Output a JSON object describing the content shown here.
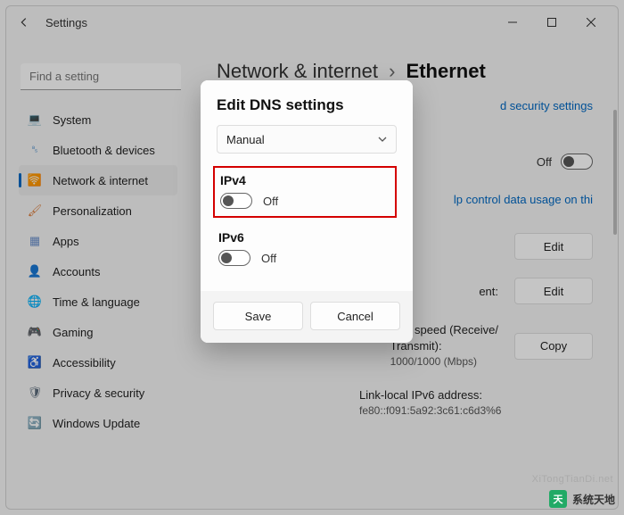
{
  "titlebar": {
    "app_title": "Settings"
  },
  "search": {
    "placeholder": "Find a setting"
  },
  "nav": {
    "items": [
      {
        "label": "System",
        "icon": "💻",
        "color": "#3b82c4"
      },
      {
        "label": "Bluetooth & devices",
        "icon": "␈",
        "color": "#3b82c4"
      },
      {
        "label": "Network & internet",
        "icon": "🛜",
        "color": "#2aa6a0"
      },
      {
        "label": "Personalization",
        "icon": "🖌",
        "color": "#d97b3a"
      },
      {
        "label": "Apps",
        "icon": "▦",
        "color": "#6b8fc9"
      },
      {
        "label": "Accounts",
        "icon": "👤",
        "color": "#5a8bb0"
      },
      {
        "label": "Time & language",
        "icon": "🌐",
        "color": "#4a9b8e"
      },
      {
        "label": "Gaming",
        "icon": "🎮",
        "color": "#5a7a5a"
      },
      {
        "label": "Accessibility",
        "icon": "♿",
        "color": "#4a7ab8"
      },
      {
        "label": "Privacy & security",
        "icon": "🛡",
        "color": "#5a6a7a"
      },
      {
        "label": "Windows Update",
        "icon": "🔄",
        "color": "#d98a3a"
      }
    ]
  },
  "breadcrumb": {
    "parent": "Network & internet",
    "current": "Ethernet"
  },
  "content": {
    "security_link_partial": "d security settings",
    "metered_off_label": "Off",
    "usage_link_partial": "lp control data usage on thi",
    "row1": {
      "label_partial": "",
      "button": "Edit"
    },
    "row2": {
      "label_partial": "ent:",
      "button": "Edit"
    },
    "row3": {
      "label1": "Link speed (Receive/",
      "label2": "Transmit):",
      "value": "1000/1000 (Mbps)",
      "button": "Copy"
    },
    "row4": {
      "label": "Link-local IPv6 address:",
      "value": "fe80::f091:5a92:3c61:c6d3%6"
    }
  },
  "dialog": {
    "title": "Edit DNS settings",
    "dropdown_value": "Manual",
    "ipv4_label": "IPv4",
    "ipv4_state": "Off",
    "ipv6_label": "IPv6",
    "ipv6_state": "Off",
    "save": "Save",
    "cancel": "Cancel"
  },
  "watermark": {
    "url": "XiTongTianDi.net",
    "text": "系统天地"
  }
}
